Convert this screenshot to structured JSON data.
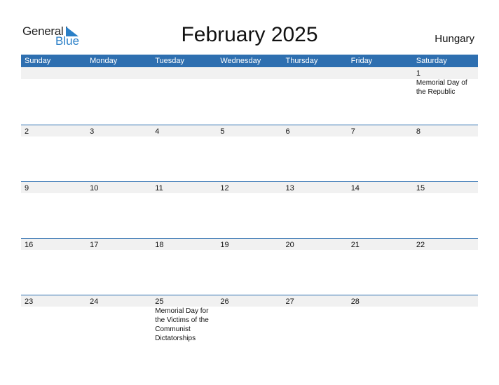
{
  "logo": {
    "word1": "General",
    "word2": "Blue"
  },
  "header": {
    "title": "February 2025",
    "country": "Hungary"
  },
  "colors": {
    "accent": "#2e6fb0",
    "band": "#f1f1f1",
    "logo_blue": "#2a7fc7"
  },
  "weekdays": [
    "Sunday",
    "Monday",
    "Tuesday",
    "Wednesday",
    "Thursday",
    "Friday",
    "Saturday"
  ],
  "weeks": [
    [
      {
        "day": ""
      },
      {
        "day": ""
      },
      {
        "day": ""
      },
      {
        "day": ""
      },
      {
        "day": ""
      },
      {
        "day": ""
      },
      {
        "day": "1",
        "event": "Memorial Day of the Republic"
      }
    ],
    [
      {
        "day": "2"
      },
      {
        "day": "3"
      },
      {
        "day": "4"
      },
      {
        "day": "5"
      },
      {
        "day": "6"
      },
      {
        "day": "7"
      },
      {
        "day": "8"
      }
    ],
    [
      {
        "day": "9"
      },
      {
        "day": "10"
      },
      {
        "day": "11"
      },
      {
        "day": "12"
      },
      {
        "day": "13"
      },
      {
        "day": "14"
      },
      {
        "day": "15"
      }
    ],
    [
      {
        "day": "16"
      },
      {
        "day": "17"
      },
      {
        "day": "18"
      },
      {
        "day": "19"
      },
      {
        "day": "20"
      },
      {
        "day": "21"
      },
      {
        "day": "22"
      }
    ],
    [
      {
        "day": "23"
      },
      {
        "day": "24"
      },
      {
        "day": "25",
        "event": "Memorial Day for the Victims of the Communist Dictatorships"
      },
      {
        "day": "26"
      },
      {
        "day": "27"
      },
      {
        "day": "28"
      },
      {
        "day": ""
      }
    ]
  ]
}
